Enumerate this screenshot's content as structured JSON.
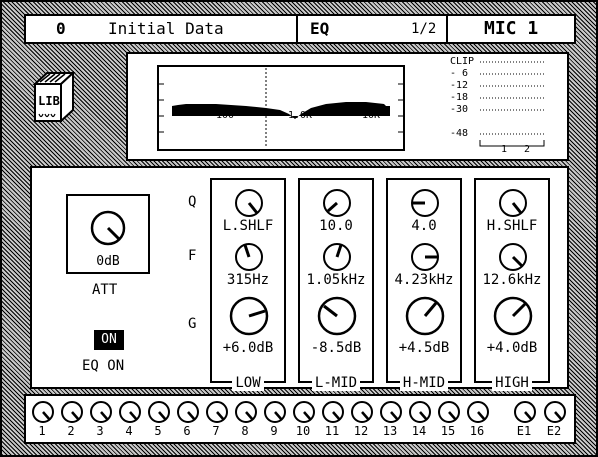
{
  "header": {
    "scene_number": "0",
    "scene_name": "Initial Data",
    "page_name": "EQ",
    "page_index": "1/2",
    "channel": "MIC 1"
  },
  "library": {
    "label": "LIB"
  },
  "eq_graph": {
    "freq_labels": [
      "100",
      "1.0K",
      "10K"
    ]
  },
  "meter": {
    "levels": [
      "CLIP",
      "- 6",
      "-12",
      "-18",
      "-30",
      "-48"
    ],
    "channels": [
      "1",
      "2"
    ]
  },
  "att": {
    "value": "0dB",
    "label": "ATT"
  },
  "eq_on": {
    "button": "ON",
    "label": "EQ ON"
  },
  "row_labels": {
    "q": "Q",
    "f": "F",
    "g": "G"
  },
  "bands": [
    {
      "name": "LOW",
      "q": "L.SHLF",
      "f": "315Hz",
      "g": "+6.0dB"
    },
    {
      "name": "L-MID",
      "q": "10.0",
      "f": "1.05kHz",
      "g": "-8.5dB"
    },
    {
      "name": "H-MID",
      "q": "4.0",
      "f": "4.23kHz",
      "g": "+4.5dB"
    },
    {
      "name": "HIGH",
      "q": "H.SHLF",
      "f": "12.6kHz",
      "g": "+4.0dB"
    }
  ],
  "strip": {
    "channels": [
      "1",
      "2",
      "3",
      "4",
      "5",
      "6",
      "7",
      "8",
      "9",
      "10",
      "11",
      "12",
      "13",
      "14",
      "15",
      "16",
      "E1",
      "E2"
    ]
  }
}
